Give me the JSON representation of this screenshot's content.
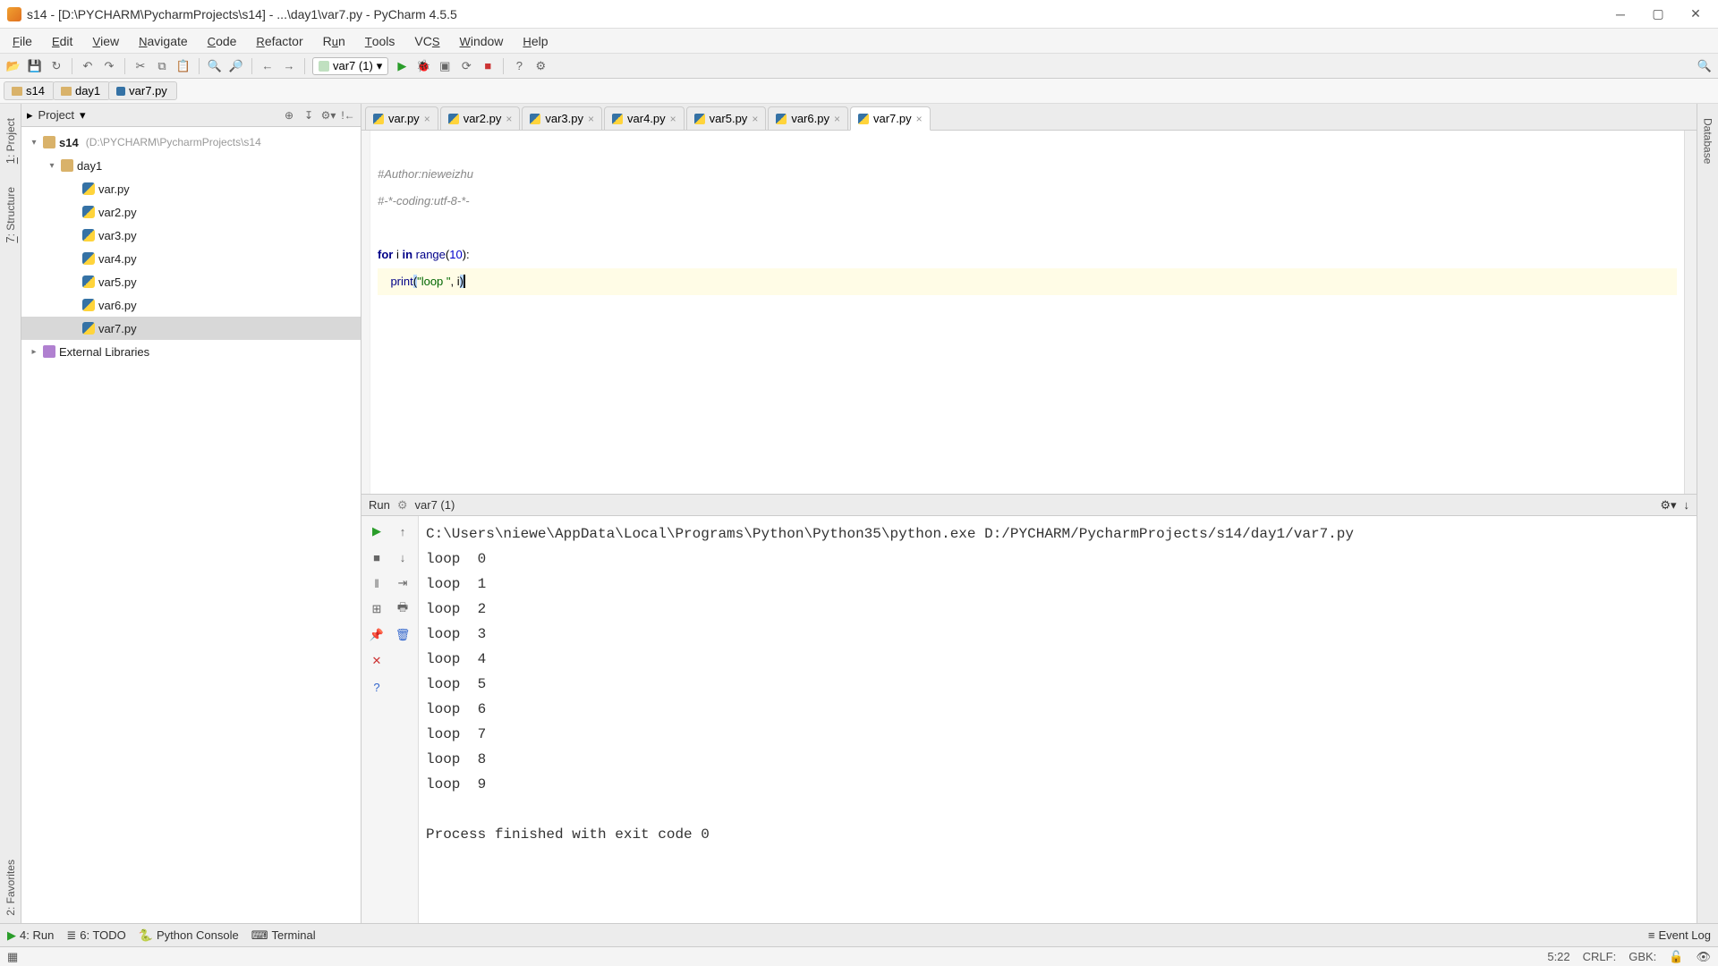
{
  "window": {
    "title": "s14 - [D:\\PYCHARM\\PycharmProjects\\s14] - ...\\day1\\var7.py - PyCharm 4.5.5"
  },
  "menu": [
    "File",
    "Edit",
    "View",
    "Navigate",
    "Code",
    "Refactor",
    "Run",
    "Tools",
    "VCS",
    "Window",
    "Help"
  ],
  "run_config": {
    "label": "var7 (1)"
  },
  "breadcrumb": [
    {
      "type": "folder",
      "label": "s14"
    },
    {
      "type": "folder",
      "label": "day1"
    },
    {
      "type": "py",
      "label": "var7.py"
    }
  ],
  "side_left": [
    "1: Project",
    "7: Structure"
  ],
  "side_left_bottom": "2: Favorites",
  "side_right": "Database",
  "project_panel": {
    "header": "Project",
    "root": {
      "name": "s14",
      "hint": "(D:\\PYCHARM\\PycharmProjects\\s14"
    },
    "folder": "day1",
    "files": [
      "var.py",
      "var2.py",
      "var3.py",
      "var4.py",
      "var5.py",
      "var6.py",
      "var7.py"
    ],
    "selected": "var7.py",
    "external": "External Libraries"
  },
  "tabs": [
    {
      "label": "var.py",
      "active": false
    },
    {
      "label": "var2.py",
      "active": false
    },
    {
      "label": "var3.py",
      "active": false
    },
    {
      "label": "var4.py",
      "active": false
    },
    {
      "label": "var5.py",
      "active": false
    },
    {
      "label": "var6.py",
      "active": false
    },
    {
      "label": "var7.py",
      "active": true
    }
  ],
  "code": {
    "line1": "#Author:nieweizhu",
    "line2": "#-*-coding:utf-8-*-",
    "line4_kw1": "for",
    "line4_var": " i ",
    "line4_kw2": "in",
    "line4_fn": " range",
    "line4_open": "(",
    "line4_num": "10",
    "line4_close": "):",
    "line5_indent": "    ",
    "line5_fn": "print",
    "line5_open": "(",
    "line5_str": "\"loop \"",
    "line5_mid": ", i",
    "line5_close": ")"
  },
  "run": {
    "title": "Run",
    "config": "var7 (1)",
    "command": "C:\\Users\\niewe\\AppData\\Local\\Programs\\Python\\Python35\\python.exe D:/PYCHARM/PycharmProjects/s14/day1/var7.py",
    "lines": [
      "loop  0",
      "loop  1",
      "loop  2",
      "loop  3",
      "loop  4",
      "loop  5",
      "loop  6",
      "loop  7",
      "loop  8",
      "loop  9"
    ],
    "exit": "Process finished with exit code 0"
  },
  "bottom": {
    "run": "4: Run",
    "todo": "6: TODO",
    "python_console": "Python Console",
    "terminal": "Terminal",
    "event_log": "Event Log"
  },
  "status": {
    "pos": "5:22",
    "eol": "CRLF:",
    "enc": "GBK:"
  }
}
